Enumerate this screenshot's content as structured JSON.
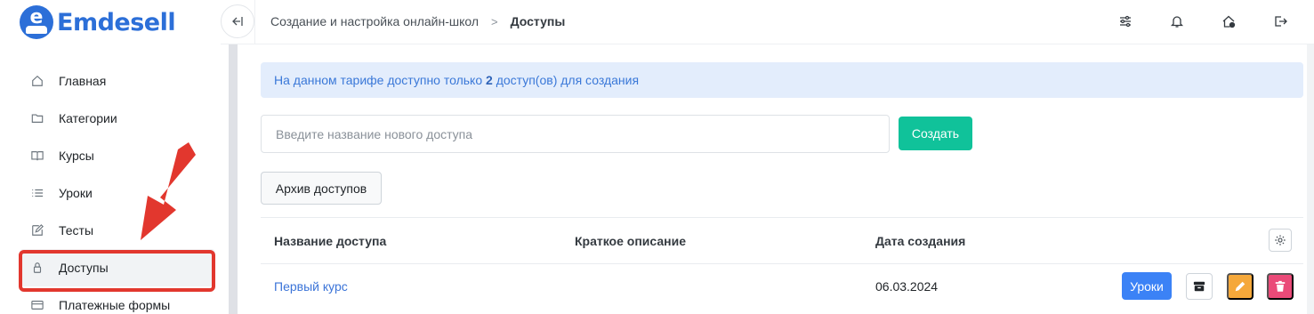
{
  "brand": {
    "name": "Emdesell",
    "color": "#2c6fd8"
  },
  "sidebar": {
    "items": [
      {
        "label": "Главная",
        "icon": "home-icon"
      },
      {
        "label": "Категории",
        "icon": "folder-icon"
      },
      {
        "label": "Курсы",
        "icon": "book-icon"
      },
      {
        "label": "Уроки",
        "icon": "list-icon"
      },
      {
        "label": "Тесты",
        "icon": "edit-icon"
      },
      {
        "label": "Доступы",
        "icon": "lock-icon",
        "active": true
      },
      {
        "label": "Платежные формы",
        "icon": "credit-card-icon"
      }
    ]
  },
  "header": {
    "breadcrumb": {
      "parent": "Создание и настройка онлайн-школ",
      "separator": ">",
      "current": "Доступы"
    },
    "icons": [
      "settings-sliders-icon",
      "bell-icon",
      "home-info-icon",
      "logout-icon"
    ]
  },
  "alert": {
    "prefix": "На данном тарифе доступно только ",
    "count": "2",
    "suffix": " доступ(ов) для создания"
  },
  "create_form": {
    "placeholder": "Введите название нового доступа",
    "value": "",
    "button": "Создать"
  },
  "archive_button": "Архив доступов",
  "table": {
    "columns": [
      "Название доступа",
      "Краткое описание",
      "Дата создания"
    ],
    "rows": [
      {
        "name": "Первый курс",
        "description": "",
        "date": "06.03.2024",
        "lessons_button": "Уроки"
      }
    ]
  },
  "colors": {
    "accent": "#10c29a",
    "primary": "#3b82f6",
    "warning": "#f5a83a",
    "danger": "#ea4a78",
    "highlight": "#e2372e"
  }
}
